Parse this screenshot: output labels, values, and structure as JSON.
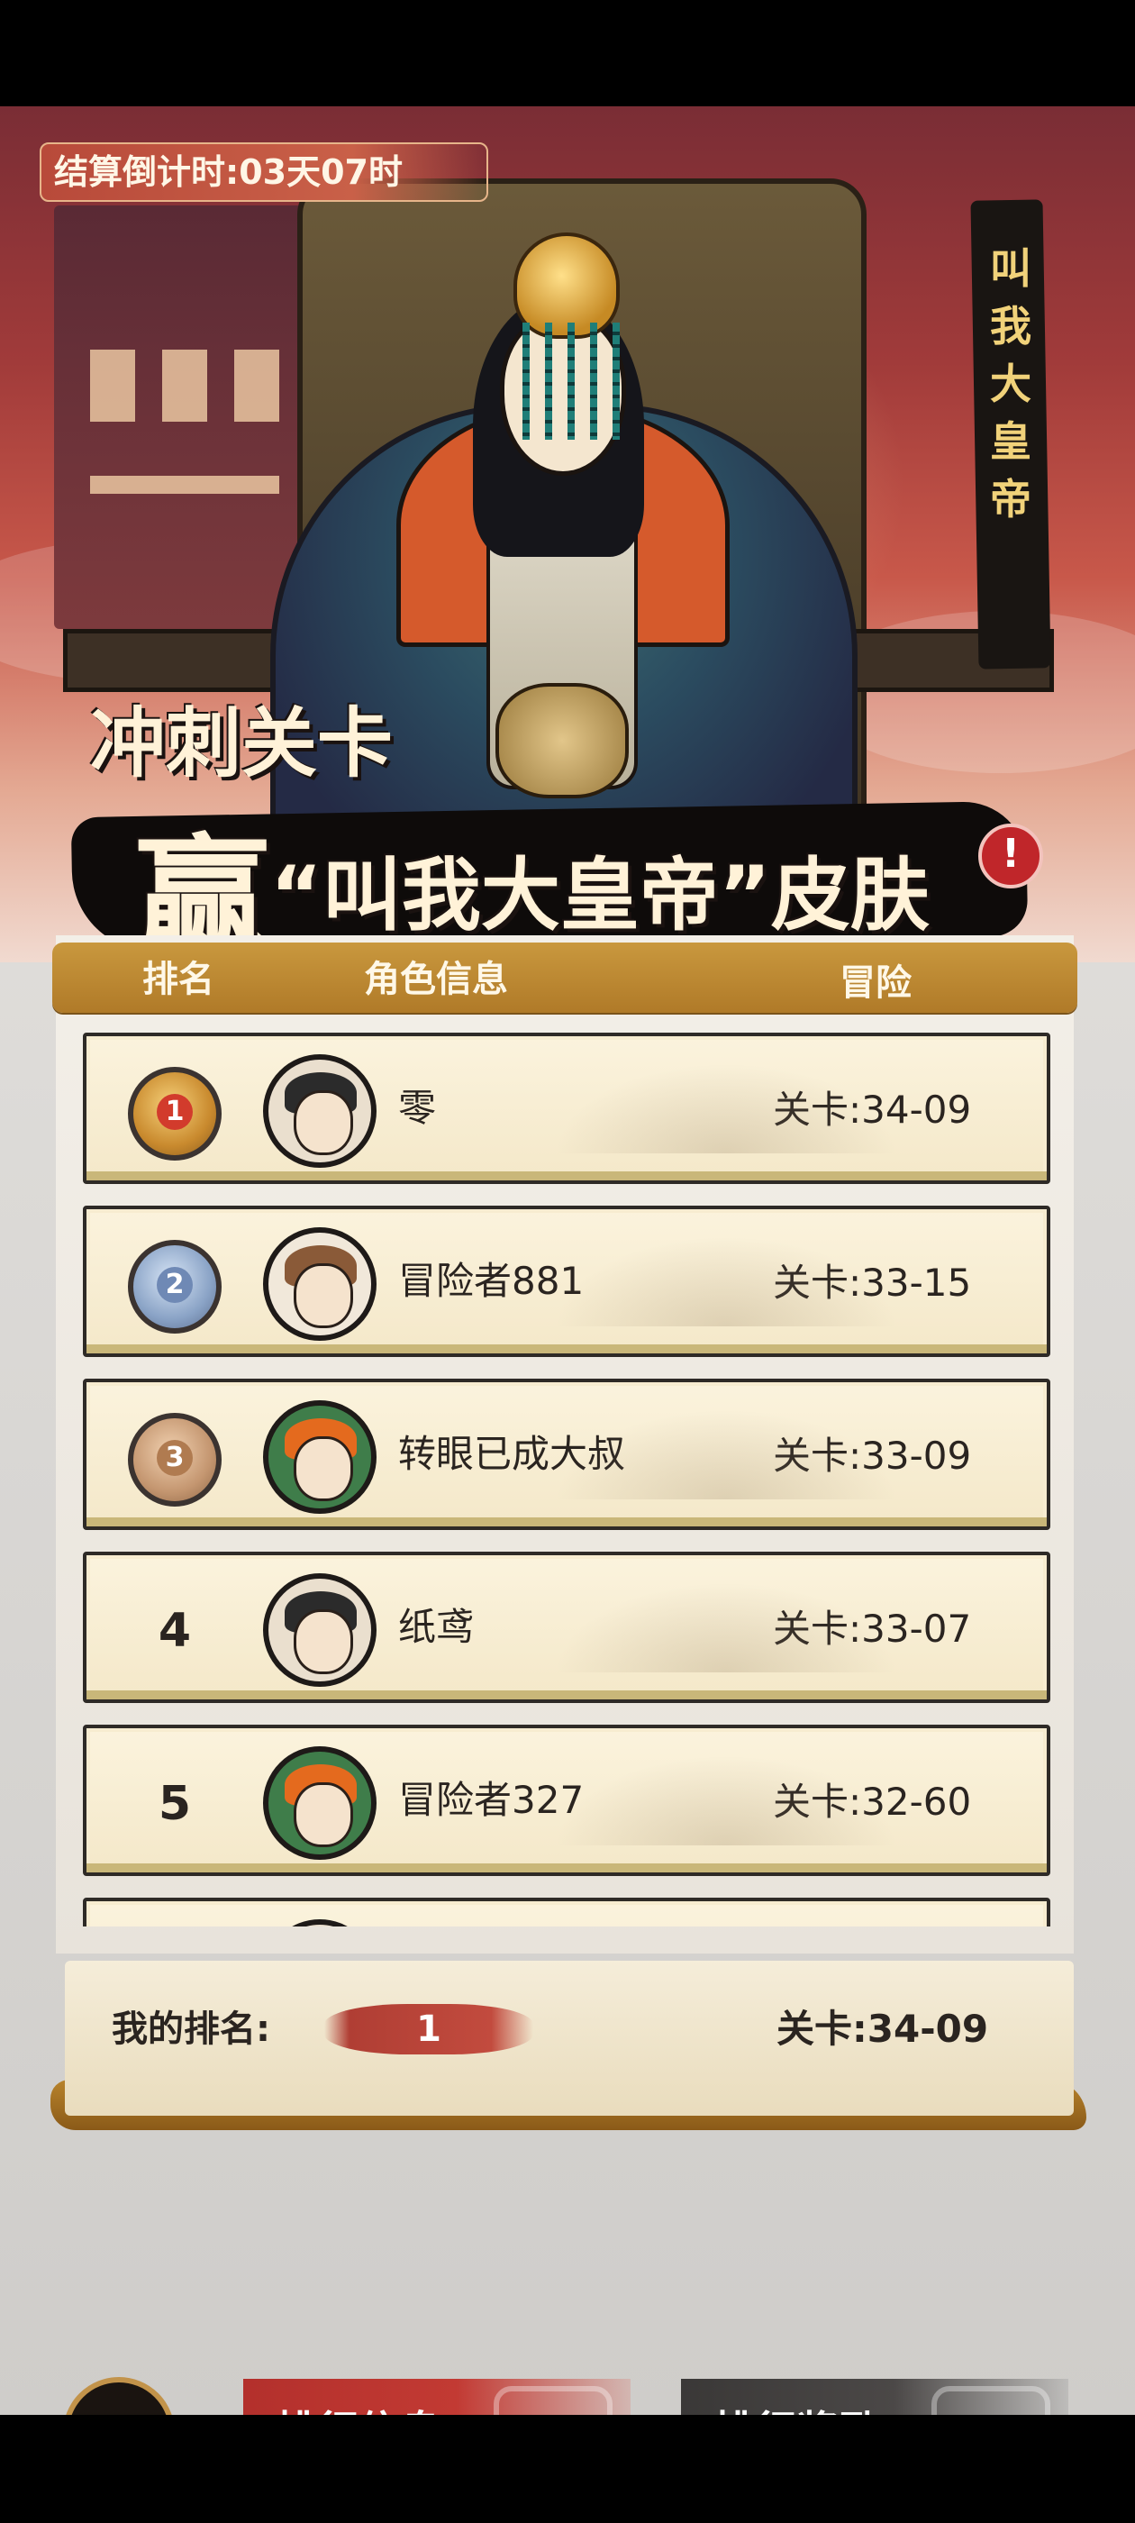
{
  "event": {
    "countdown": "结算倒计时:03天07时",
    "vertical_title": [
      "叫",
      "我",
      "大",
      "皇",
      "帝"
    ],
    "headline_small": "冲刺关卡",
    "headline_win": "赢",
    "headline_rest": "“叫我大皇帝”皮肤",
    "info_badge": "!"
  },
  "table": {
    "headers": {
      "rank": "排名",
      "character": "角色信息",
      "adventure": "冒险"
    },
    "rows": [
      {
        "rank": "1",
        "medal": "gold",
        "avatar": "av-dark",
        "name": "零",
        "stage": "关卡:34-09"
      },
      {
        "rank": "2",
        "medal": "silver",
        "avatar": "av-brown",
        "name": "冒险者881",
        "stage": "关卡:33-15"
      },
      {
        "rank": "3",
        "medal": "bronze",
        "avatar": "av-red",
        "name": "转眼已成大叔",
        "stage": "关卡:33-09"
      },
      {
        "rank": "4",
        "medal": "",
        "avatar": "av-dark",
        "name": "纸鸢",
        "stage": "关卡:33-07"
      },
      {
        "rank": "5",
        "medal": "",
        "avatar": "av-red",
        "name": "冒险者327",
        "stage": "关卡:32-60"
      }
    ]
  },
  "my_rank": {
    "label": "我的排名:",
    "value": "1",
    "stage": "关卡:34-09"
  },
  "nav": {
    "back_icon": "back-arrow-icon",
    "tab_info": "排行信息",
    "tab_reward": "排行奖励"
  },
  "colors": {
    "header_gold": "#c9983e",
    "active_tab": "#b3302c",
    "inactive_tab": "#3a3837"
  }
}
